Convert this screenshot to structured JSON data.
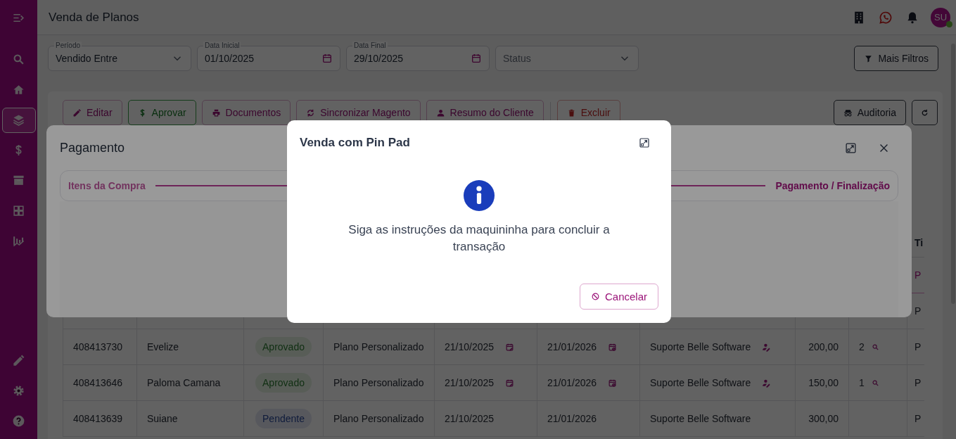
{
  "header": {
    "title": "Venda de Planos",
    "avatar": "SU",
    "online": true
  },
  "sidebar": {
    "items": [
      {
        "selected": false
      },
      {
        "selected": false
      },
      {
        "selected": true
      },
      {
        "selected": false
      },
      {
        "selected": false
      },
      {
        "selected": false
      },
      {
        "selected": false
      }
    ],
    "footer_items": [
      {
        "selected": false
      },
      {
        "selected": false
      },
      {
        "selected": false
      }
    ]
  },
  "filters": [
    {
      "kind": "select",
      "label": "Período",
      "value": "Vendido Entre"
    },
    {
      "kind": "date",
      "label": "Data Inicial",
      "value": "01/10/2025"
    },
    {
      "kind": "date",
      "label": "Data Final",
      "value": "29/10/2025"
    },
    {
      "kind": "select",
      "placeholder": "Status"
    }
  ],
  "more_filters": "Mais Filtros",
  "toolbar": {
    "actions": [
      {
        "kind": "edit",
        "label": "Editar"
      },
      {
        "kind": "approve",
        "label": "Aprovar"
      },
      {
        "kind": "print",
        "label": "Documentos"
      },
      {
        "kind": "sync",
        "label": "Sincronizar Magento"
      },
      {
        "kind": "person",
        "label": "Resumo do Cliente"
      },
      {
        "kind": "delete",
        "label": "Excluir"
      }
    ],
    "right": [
      {
        "kind": "audit",
        "label": "Auditoria"
      },
      {
        "kind": "refresh"
      }
    ]
  },
  "table": {
    "header_tail": "Ti",
    "rows": [
      {
        "selected": true,
        "tail": "P"
      },
      {
        "selected": false,
        "tail": "P"
      },
      {
        "selected": false,
        "id": "408413730",
        "name": "Evelize",
        "status": {
          "label": "Aprovado",
          "kind": "approved"
        },
        "plan": "Plano Personalizado",
        "start": "21/10/2025",
        "end": "21/01/2026",
        "seller": "Suporte Belle Software",
        "value": "200,00",
        "count": "2",
        "icons": true,
        "tail": "P"
      },
      {
        "selected": false,
        "id": "408413646",
        "name": "Paloma Camana",
        "status": {
          "label": "Aprovado",
          "kind": "approved"
        },
        "plan": "Plano Personalizado",
        "start": "21/10/2025",
        "end": "21/01/2026",
        "seller": "Suporte Belle Software",
        "value": "150,00",
        "count": "1",
        "icons": true,
        "tail": "P"
      },
      {
        "selected": false,
        "id": "408413639",
        "name": "Suiane",
        "status": {
          "label": "Pendente",
          "kind": "pending"
        },
        "plan": "Plano Personalizado",
        "start": "21/10/2025",
        "end": "21/01/2026",
        "seller": "Suporte Belle Software",
        "value": "300,00",
        "icons": false,
        "tail": "P"
      }
    ]
  },
  "payment_dialog": {
    "title": "Pagamento",
    "steps": [
      {
        "label": "Itens da Compra",
        "selected": false
      },
      {
        "label": "Pagamento / Finalização",
        "selected": true
      }
    ]
  },
  "pinpad_dialog": {
    "title": "Venda com Pin Pad",
    "message": "Siga as instruções da maquininha para concluir a transação",
    "cancel": "Cancelar"
  }
}
